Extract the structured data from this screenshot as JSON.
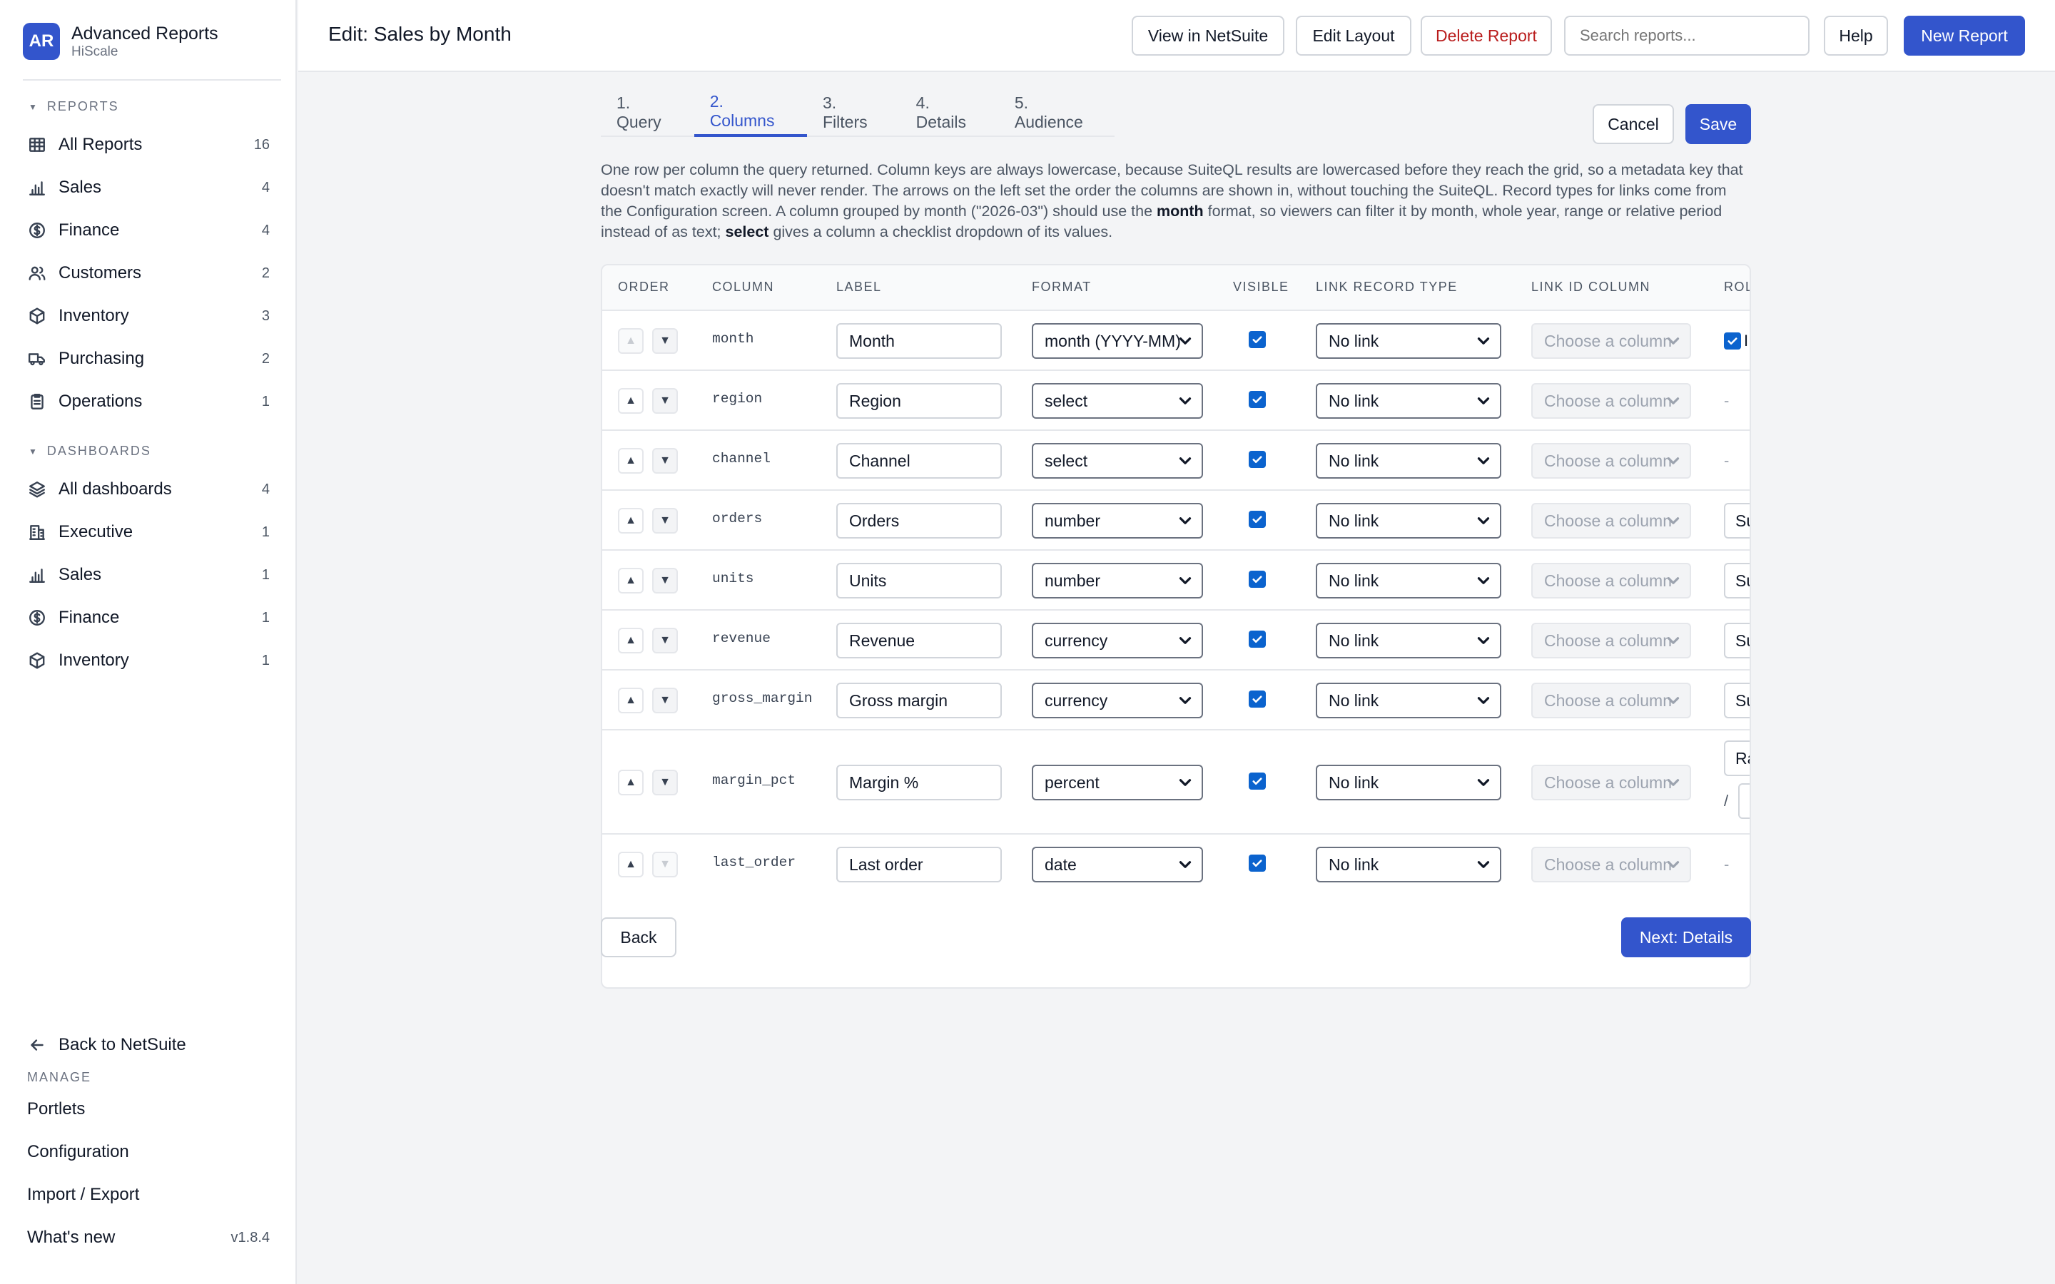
{
  "sidebar": {
    "logo_text": "AR",
    "app_name": "Advanced Reports",
    "org_name": "HiScale",
    "reports_heading": "REPORTS",
    "reports": [
      {
        "label": "All Reports",
        "count": "16",
        "icon": "table-icon"
      },
      {
        "label": "Sales",
        "count": "4",
        "icon": "bar-chart-icon"
      },
      {
        "label": "Finance",
        "count": "4",
        "icon": "dollar-circle-icon"
      },
      {
        "label": "Customers",
        "count": "2",
        "icon": "users-icon"
      },
      {
        "label": "Inventory",
        "count": "3",
        "icon": "box-icon"
      },
      {
        "label": "Purchasing",
        "count": "2",
        "icon": "truck-icon"
      },
      {
        "label": "Operations",
        "count": "1",
        "icon": "clipboard-icon"
      }
    ],
    "dashboards_heading": "DASHBOARDS",
    "dashboards": [
      {
        "label": "All dashboards",
        "count": "4",
        "icon": "layers-icon"
      },
      {
        "label": "Executive",
        "count": "1",
        "icon": "building-icon"
      },
      {
        "label": "Sales",
        "count": "1",
        "icon": "bar-chart-icon"
      },
      {
        "label": "Finance",
        "count": "1",
        "icon": "dollar-circle-icon"
      },
      {
        "label": "Inventory",
        "count": "1",
        "icon": "box-icon"
      }
    ],
    "back_label": "Back to NetSuite",
    "manage_heading": "MANAGE",
    "manage_items": [
      "Portlets",
      "Configuration",
      "Import / Export"
    ],
    "whats_new_label": "What's new",
    "version": "v1.8.4"
  },
  "topbar": {
    "title": "Edit: Sales by Month",
    "view_in_netsuite": "View in NetSuite",
    "edit_layout": "Edit Layout",
    "delete_report": "Delete Report",
    "search_placeholder": "Search reports...",
    "help": "Help",
    "new_report": "New Report"
  },
  "tabs": [
    "1. Query",
    "2. Columns",
    "3. Filters",
    "4. Details",
    "5. Audience"
  ],
  "active_tab": "2. Columns",
  "actions": {
    "cancel": "Cancel",
    "save": "Save"
  },
  "intro": {
    "part1": "One row per column the query returned. Column keys are always lowercase, because SuiteQL results are lowercased before they reach the grid, so a metadata key that doesn't match exactly will never render. The arrows on the left set the order the columns are shown in, without touching the SuiteQL. Record types for links come from the Configuration screen. A column grouped by month (\"2026-03\") should use the ",
    "bold1": "month",
    "part2": " format, so viewers can filter it by month, whole year, range or relative period instead of as text; ",
    "bold2": "select",
    "part3": " gives a column a checklist dropdown of its values."
  },
  "grid": {
    "headers": {
      "order": "ORDER",
      "column": "COLUMN",
      "label": "LABEL",
      "format": "FORMAT",
      "visible": "VISIBLE",
      "link_record_type": "LINK RECORD TYPE",
      "link_id_column": "LINK ID COLUMN",
      "rollup": "ROL"
    },
    "rows": [
      {
        "key": "month",
        "label": "Month",
        "format": "month (YYYY-MM)",
        "visible": true,
        "link_type": "No link",
        "link_id": "Choose a column",
        "rollup": "check",
        "rollup_text": "I"
      },
      {
        "key": "region",
        "label": "Region",
        "format": "select",
        "visible": true,
        "link_type": "No link",
        "link_id": "Choose a column",
        "rollup": "dash",
        "rollup_text": "-"
      },
      {
        "key": "channel",
        "label": "Channel",
        "format": "select",
        "visible": true,
        "link_type": "No link",
        "link_id": "Choose a column",
        "rollup": "dash",
        "rollup_text": "-"
      },
      {
        "key": "orders",
        "label": "Orders",
        "format": "number",
        "visible": true,
        "link_type": "No link",
        "link_id": "Choose a column",
        "rollup": "select",
        "rollup_text": "Su"
      },
      {
        "key": "units",
        "label": "Units",
        "format": "number",
        "visible": true,
        "link_type": "No link",
        "link_id": "Choose a column",
        "rollup": "select",
        "rollup_text": "Su"
      },
      {
        "key": "revenue",
        "label": "Revenue",
        "format": "currency",
        "visible": true,
        "link_type": "No link",
        "link_id": "Choose a column",
        "rollup": "select",
        "rollup_text": "Su"
      },
      {
        "key": "gross_margin",
        "label": "Gross margin",
        "format": "currency",
        "visible": true,
        "link_type": "No link",
        "link_id": "Choose a column",
        "rollup": "select",
        "rollup_text": "Su"
      },
      {
        "key": "margin_pct",
        "label": "Margin %",
        "format": "percent",
        "visible": true,
        "link_type": "No link",
        "link_id": "Choose a column",
        "rollup": "ratio",
        "rollup_text": "Ra",
        "rollup_slash": "/"
      },
      {
        "key": "last_order",
        "label": "Last order",
        "format": "date",
        "visible": true,
        "link_type": "No link",
        "link_id": "Choose a column",
        "rollup": "dash",
        "rollup_text": "-"
      }
    ]
  },
  "footer": {
    "back": "Back",
    "next": "Next: Details"
  },
  "colors": {
    "accent": "#3355cc",
    "danger": "#b91c1c",
    "checkbox": "#0b63ce"
  }
}
